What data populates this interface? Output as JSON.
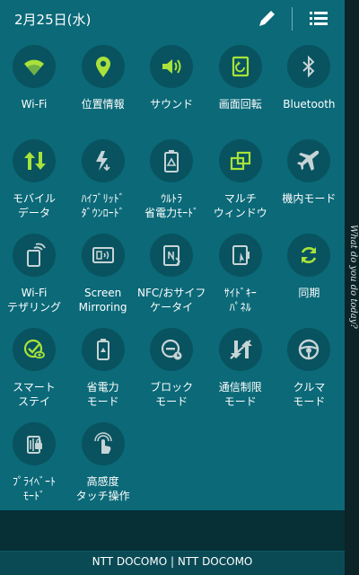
{
  "header": {
    "date": "2月25日(水)",
    "edit_icon": "pencil-icon",
    "menu_icon": "list-icon"
  },
  "colors": {
    "panel": "#0b6978",
    "circle": "#08535f",
    "active": "#a8e23a",
    "inactive": "#c7d4d6"
  },
  "tiles": [
    {
      "id": "wifi",
      "line1": "Wi-Fi",
      "line2": "",
      "active": true,
      "icon": "wifi-icon"
    },
    {
      "id": "location",
      "line1": "位置情報",
      "line2": "",
      "active": true,
      "icon": "location-pin-icon"
    },
    {
      "id": "sound",
      "line1": "サウンド",
      "line2": "",
      "active": true,
      "icon": "speaker-icon"
    },
    {
      "id": "rotation",
      "line1": "画面回転",
      "line2": "",
      "active": true,
      "icon": "rotate-screen-icon"
    },
    {
      "id": "bluetooth",
      "line1": "Bluetooth",
      "line2": "",
      "active": false,
      "icon": "bluetooth-icon"
    },
    {
      "id": "mobile-data",
      "line1": "モバイル",
      "line2": "データ",
      "active": true,
      "icon": "data-arrows-icon"
    },
    {
      "id": "hybrid-download",
      "line1": "ﾊｲﾌﾞﾘｯﾄﾞ",
      "line2": "ﾀﾞｳﾝﾛｰﾄﾞ",
      "active": false,
      "icon": "hybrid-download-icon"
    },
    {
      "id": "ultra-power",
      "line1": "ｳﾙﾄﾗ",
      "line2": "省電力ﾓｰﾄﾞ",
      "active": false,
      "icon": "battery-recycle-icon"
    },
    {
      "id": "multi-window",
      "line1": "マルチ",
      "line2": "ウィンドウ",
      "active": true,
      "icon": "multi-window-icon"
    },
    {
      "id": "airplane",
      "line1": "機内モード",
      "line2": "",
      "active": false,
      "icon": "airplane-icon"
    },
    {
      "id": "tethering",
      "line1": "Wi-Fi",
      "line2": "テザリング",
      "active": false,
      "icon": "tethering-icon"
    },
    {
      "id": "screen-mirroring",
      "line1": "Screen",
      "line2": "Mirroring",
      "active": false,
      "icon": "screen-mirroring-icon"
    },
    {
      "id": "nfc",
      "line1": "NFC/おサイフ",
      "line2": "ケータイ",
      "active": false,
      "icon": "nfc-icon"
    },
    {
      "id": "side-key",
      "line1": "ｻｲﾄﾞｷｰ",
      "line2": "ﾊﾟﾈﾙ",
      "active": false,
      "icon": "side-key-icon"
    },
    {
      "id": "sync",
      "line1": "同期",
      "line2": "",
      "active": true,
      "icon": "sync-icon"
    },
    {
      "id": "smart-stay",
      "line1": "スマート",
      "line2": "ステイ",
      "active": true,
      "icon": "smart-stay-icon"
    },
    {
      "id": "power-saving",
      "line1": "省電力",
      "line2": "モード",
      "active": false,
      "icon": "battery-saver-icon"
    },
    {
      "id": "block",
      "line1": "ブロック",
      "line2": "モード",
      "active": false,
      "icon": "block-mode-icon"
    },
    {
      "id": "data-limit",
      "line1": "通信制限",
      "line2": "モード",
      "active": false,
      "icon": "data-limit-icon"
    },
    {
      "id": "car-mode",
      "line1": "クルマ",
      "line2": "モード",
      "active": false,
      "icon": "steering-wheel-icon"
    },
    {
      "id": "private-mode",
      "line1": "ﾌﾟﾗｲﾍﾞｰﾄ",
      "line2": "ﾓｰﾄﾞ",
      "active": false,
      "icon": "private-mode-icon"
    },
    {
      "id": "touch-sensitivity",
      "line1": "高感度",
      "line2": "タッチ操作",
      "active": false,
      "icon": "touch-hand-icon"
    }
  ],
  "side_text": "What do you do today?",
  "footer": {
    "carrier": "NTT DOCOMO | NTT DOCOMO"
  }
}
